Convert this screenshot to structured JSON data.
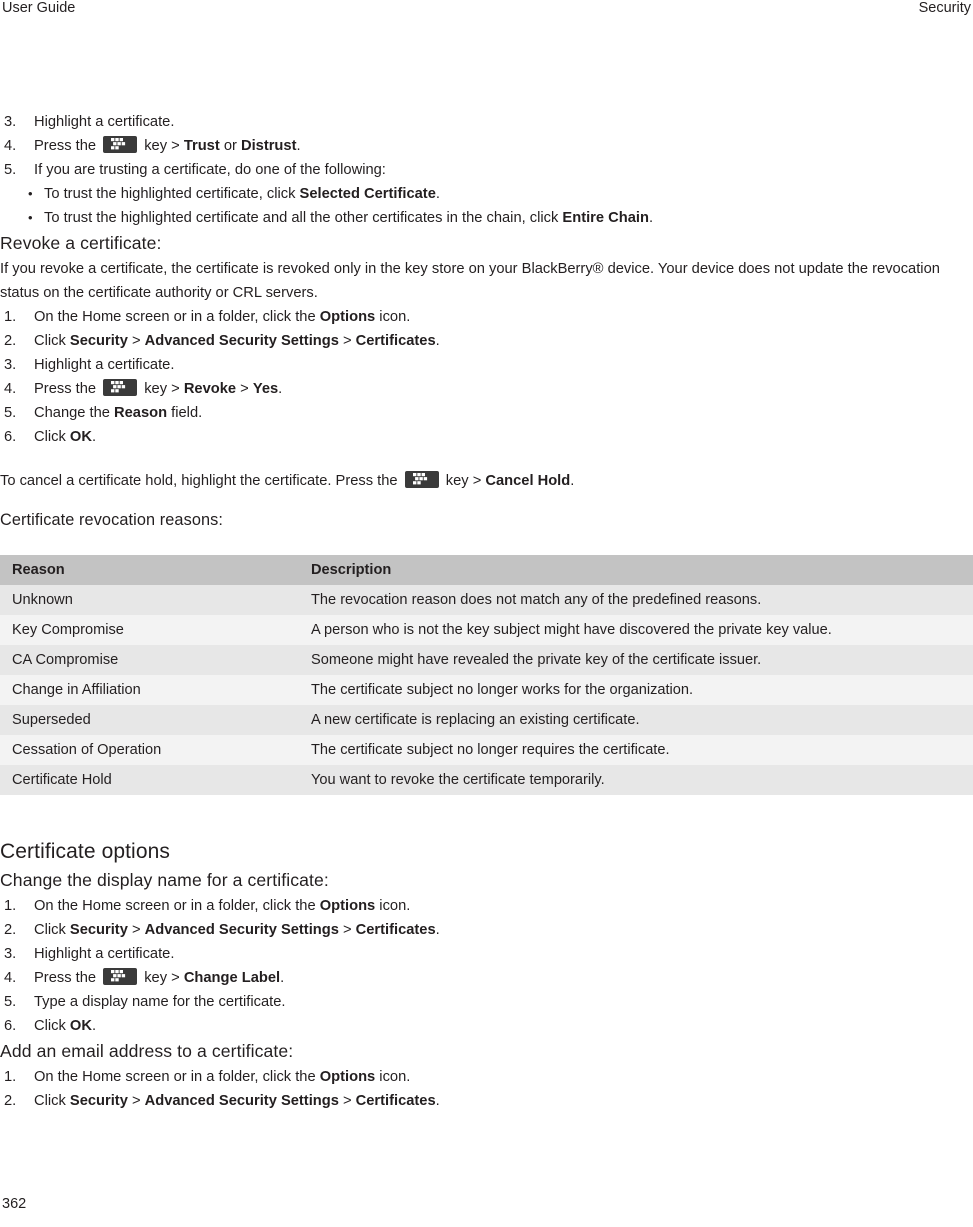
{
  "running_head": {
    "left": "User Guide",
    "right": "Security"
  },
  "icons": {
    "menu_key": "blackberry-menu-key-icon"
  },
  "blocks": {
    "trust_steps": [
      {
        "marker": "3.",
        "text": "Highlight a certificate."
      },
      {
        "marker": "4.",
        "pre": "Press the ",
        "mid": " key > ",
        "bold1": "Trust",
        "between": " or ",
        "bold2": "Distrust",
        "post": "."
      },
      {
        "marker": "5.",
        "text": "If you are trusting a certificate, do one of the following:"
      }
    ],
    "trust_bullets": [
      {
        "pre": "To trust the highlighted certificate, click ",
        "bold": "Selected Certificate",
        "post": "."
      },
      {
        "pre": "To trust the highlighted certificate and all the other certificates in the chain, click ",
        "bold": "Entire Chain",
        "post": "."
      }
    ],
    "revoke_heading": "Revoke a certificate:",
    "revoke_intro": "If you revoke a certificate, the certificate is revoked only in the key store on your BlackBerry® device. Your device does not update the revocation status on the certificate authority or CRL servers.",
    "revoke_steps": [
      {
        "marker": "1.",
        "pre": "On the Home screen or in a folder, click the ",
        "bold": "Options",
        "post": " icon."
      },
      {
        "marker": "2.",
        "pre": "Click ",
        "bold": "Security",
        "mid1": " > ",
        "bold2": "Advanced Security Settings",
        "mid2": " > ",
        "bold3": "Certificates",
        "post": "."
      },
      {
        "marker": "3.",
        "text": "Highlight a certificate."
      },
      {
        "marker": "4.",
        "pre": "Press the ",
        "mid": " key > ",
        "bold1": "Revoke",
        "between": " > ",
        "bold2": "Yes",
        "post": "."
      },
      {
        "marker": "5.",
        "pre": "Change the ",
        "bold": "Reason",
        "post": " field."
      },
      {
        "marker": "6.",
        "pre": "Click ",
        "bold": "OK",
        "post": "."
      }
    ],
    "cancel_hold": {
      "pre": "To cancel a certificate hold, highlight the certificate. Press the ",
      "mid": " key > ",
      "bold": "Cancel Hold",
      "post": "."
    },
    "reasons_heading": "Certificate revocation reasons:",
    "certificate_options_heading": "Certificate options",
    "display_name_heading": "Change the display name for a certificate:",
    "display_name_steps": [
      {
        "marker": "1.",
        "pre": "On the Home screen or in a folder, click the ",
        "bold": "Options",
        "post": " icon."
      },
      {
        "marker": "2.",
        "pre": "Click ",
        "bold": "Security",
        "mid1": " > ",
        "bold2": "Advanced Security Settings",
        "mid2": " > ",
        "bold3": "Certificates",
        "post": "."
      },
      {
        "marker": "3.",
        "text": "Highlight a certificate."
      },
      {
        "marker": "4.",
        "pre": "Press the ",
        "mid": " key > ",
        "bold1": "Change Label",
        "post": "."
      },
      {
        "marker": "5.",
        "text": "Type a display name for the certificate."
      },
      {
        "marker": "6.",
        "pre": "Click ",
        "bold": "OK",
        "post": "."
      }
    ],
    "email_address_heading": "Add an email address to a certificate:",
    "email_address_steps": [
      {
        "marker": "1.",
        "pre": "On the Home screen or in a folder, click the ",
        "bold": "Options",
        "post": " icon."
      },
      {
        "marker": "2.",
        "pre": "Click ",
        "bold": "Security",
        "mid1": " > ",
        "bold2": "Advanced Security Settings",
        "mid2": " > ",
        "bold3": "Certificates",
        "post": "."
      }
    ]
  },
  "table": {
    "headers": [
      "Reason",
      "Description"
    ],
    "rows": [
      [
        "Unknown",
        "The revocation reason does not match any of the predefined reasons."
      ],
      [
        "Key Compromise",
        "A person who is not the key subject might have discovered the private key value."
      ],
      [
        "CA Compromise",
        "Someone might have revealed the private key of the certificate issuer."
      ],
      [
        "Change in Affiliation",
        "The certificate subject no longer works for the organization."
      ],
      [
        "Superseded",
        "A new certificate is replacing an existing certificate."
      ],
      [
        "Cessation of Operation",
        "The certificate subject no longer requires the certificate."
      ],
      [
        "Certificate Hold",
        "You want to revoke the certificate temporarily."
      ]
    ]
  },
  "folio": "362"
}
